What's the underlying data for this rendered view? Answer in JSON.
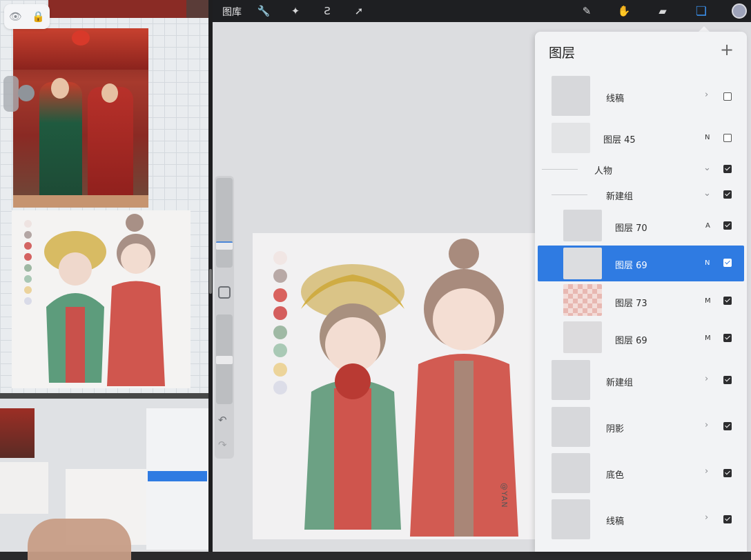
{
  "toolbar": {
    "gallery_label": "图库",
    "icons": [
      "wrench-icon",
      "magic-wand-icon",
      "selection-icon",
      "transform-icon",
      "brush-icon",
      "smudge-icon",
      "eraser-icon",
      "layers-icon"
    ]
  },
  "reference": {
    "toolbar_icons": [
      "eye-icon",
      "lock-icon"
    ]
  },
  "canvas": {
    "watermark": "@YAN",
    "swatches": [
      "#f1e6e4",
      "#b8a9a6",
      "#d9625e",
      "#d45e5d",
      "#9fb9a4",
      "#a9c9b5",
      "#ecd49a",
      "#dcdde8"
    ]
  },
  "layers_panel": {
    "title": "图层",
    "add_label": "+",
    "layers": [
      {
        "name": "线稿",
        "mode": "",
        "group": true,
        "expanded": false,
        "visible": false
      },
      {
        "name": "图层 45",
        "mode": "N",
        "group": false,
        "visible": false
      },
      {
        "name": "人物",
        "mode": "",
        "group": true,
        "expanded": true,
        "visible": true
      },
      {
        "name": "新建组",
        "mode": "",
        "group": true,
        "expanded": true,
        "visible": true
      },
      {
        "name": "图层 70",
        "mode": "A",
        "group": false,
        "visible": true
      },
      {
        "name": "图层 69",
        "mode": "N",
        "group": false,
        "visible": true,
        "selected": true
      },
      {
        "name": "图层 73",
        "mode": "M",
        "group": false,
        "visible": true
      },
      {
        "name": "图层 69",
        "mode": "M",
        "group": false,
        "visible": true
      },
      {
        "name": "新建组",
        "mode": "",
        "group": true,
        "expanded": false,
        "visible": true
      },
      {
        "name": "阴影",
        "mode": "",
        "group": true,
        "expanded": false,
        "visible": true
      },
      {
        "name": "底色",
        "mode": "",
        "group": true,
        "expanded": false,
        "visible": true
      },
      {
        "name": "线稿",
        "mode": "",
        "group": true,
        "expanded": false,
        "visible": true
      }
    ]
  },
  "colors": {
    "accent": "#2f7be2",
    "active_color": "#9ea3ba"
  }
}
